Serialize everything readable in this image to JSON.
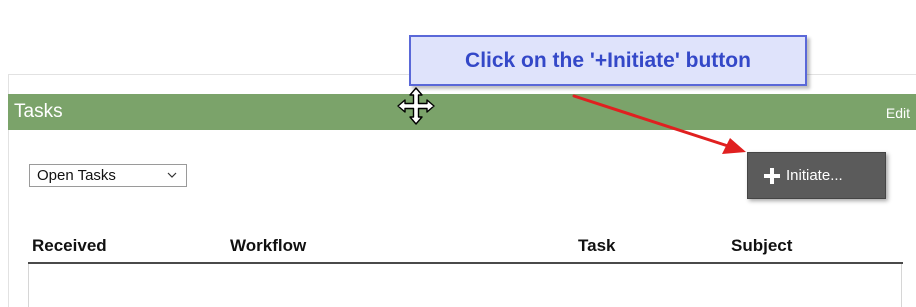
{
  "callout": {
    "text": "Click on the '+Initiate' button"
  },
  "panel": {
    "title": "Tasks",
    "edit_label": "Edit"
  },
  "filter": {
    "selected": "Open Tasks"
  },
  "initiate_button": {
    "label": "Initiate..."
  },
  "table": {
    "columns": [
      "Received",
      "Workflow",
      "Task",
      "Subject"
    ],
    "rows": []
  },
  "colors": {
    "header_bg": "#7ba36a",
    "button_bg": "#5b5b5b",
    "callout_bg": "#dfe3fb",
    "callout_border": "#5a68d8",
    "callout_text": "#3448c8",
    "arrow": "#e02020"
  },
  "icons": {
    "move": "move-cursor-icon",
    "plus": "plus-icon",
    "chevron": "chevron-down-icon"
  }
}
